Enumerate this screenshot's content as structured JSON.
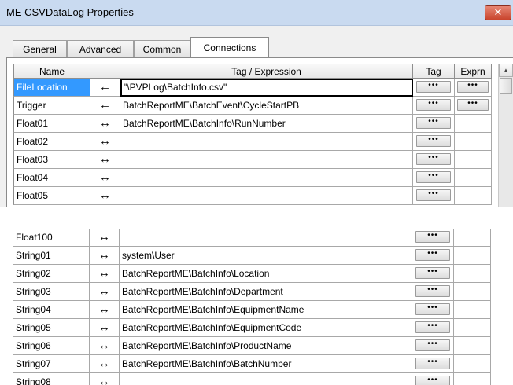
{
  "window": {
    "title": "ME CSVDataLog Properties",
    "close_label": "✕"
  },
  "tabs": [
    {
      "label": "General"
    },
    {
      "label": "Advanced"
    },
    {
      "label": "Common"
    },
    {
      "label": "Connections"
    }
  ],
  "active_tab": "Connections",
  "grid": {
    "columns": [
      "Name",
      "",
      "Tag / Expression",
      "Tag",
      "Exprn"
    ],
    "button_label": "•••",
    "rows_top": [
      {
        "name": "FileLocation",
        "dir": "←",
        "tag": "\"\\PVPLog\\BatchInfo.csv\"",
        "exprn_btn": true
      },
      {
        "name": "Trigger",
        "dir": "←",
        "tag": "BatchReportME\\BatchEvent\\CycleStartPB",
        "exprn_btn": true
      },
      {
        "name": "Float01",
        "dir": "↔",
        "tag": "BatchReportME\\BatchInfo\\RunNumber",
        "exprn_btn": false
      },
      {
        "name": "Float02",
        "dir": "↔",
        "tag": "",
        "exprn_btn": false
      },
      {
        "name": "Float03",
        "dir": "↔",
        "tag": "",
        "exprn_btn": false
      },
      {
        "name": "Float04",
        "dir": "↔",
        "tag": "",
        "exprn_btn": false
      },
      {
        "name": "Float05",
        "dir": "↔",
        "tag": "",
        "exprn_btn": false
      }
    ],
    "rows_bottom": [
      {
        "name": "Float100",
        "dir": "↔",
        "tag": ""
      },
      {
        "name": "String01",
        "dir": "↔",
        "tag": "system\\User"
      },
      {
        "name": "String02",
        "dir": "↔",
        "tag": "BatchReportME\\BatchInfo\\Location"
      },
      {
        "name": "String03",
        "dir": "↔",
        "tag": "BatchReportME\\BatchInfo\\Department"
      },
      {
        "name": "String04",
        "dir": "↔",
        "tag": "BatchReportME\\BatchInfo\\EquipmentName"
      },
      {
        "name": "String05",
        "dir": "↔",
        "tag": "BatchReportME\\BatchInfo\\EquipmentCode"
      },
      {
        "name": "String06",
        "dir": "↔",
        "tag": "BatchReportME\\BatchInfo\\ProductName"
      },
      {
        "name": "String07",
        "dir": "↔",
        "tag": "BatchReportME\\BatchInfo\\BatchNumber"
      },
      {
        "name": "String08",
        "dir": "↔",
        "tag": ""
      }
    ]
  },
  "colors": {
    "titlebar": "#c9daf0",
    "selection": "#3399ff",
    "close_button": "#c9442d"
  }
}
